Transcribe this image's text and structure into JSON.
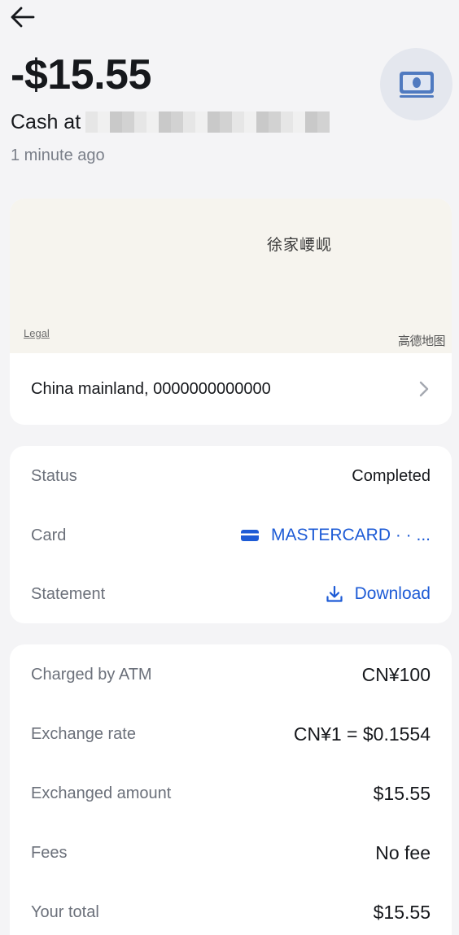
{
  "header": {
    "amount": "-$15.55",
    "merchant_prefix": "Cash at",
    "time_ago": "1 minute ago"
  },
  "map": {
    "place_label": "徐家崾岘",
    "legal_label": "Legal",
    "provider_label": "高德地图",
    "location_text": "China mainland, 0000000000000"
  },
  "details": {
    "status_label": "Status",
    "status_value": "Completed",
    "card_label": "Card",
    "card_value": "MASTERCARD · · ...",
    "statement_label": "Statement",
    "statement_value": "Download"
  },
  "costs": {
    "charged_label": "Charged by ATM",
    "charged_value": "CN¥100",
    "rate_label": "Exchange rate",
    "rate_value": "CN¥1 = $0.1554",
    "exchanged_label": "Exchanged amount",
    "exchanged_value": "$15.55",
    "fees_label": "Fees",
    "fees_value": "No fee",
    "total_label": "Your total",
    "total_value": "$15.55"
  },
  "colors": {
    "accent": "#1d5bd6",
    "muted": "#6b707a",
    "background": "#f4f4f6",
    "avatar_bg": "#e4e7ee",
    "icon_blue": "#4f7ac0"
  },
  "icons": {
    "back": "arrow-left-icon",
    "category": "cash-icon",
    "chevron": "chevron-right-icon",
    "card": "credit-card-icon",
    "download": "download-icon"
  }
}
